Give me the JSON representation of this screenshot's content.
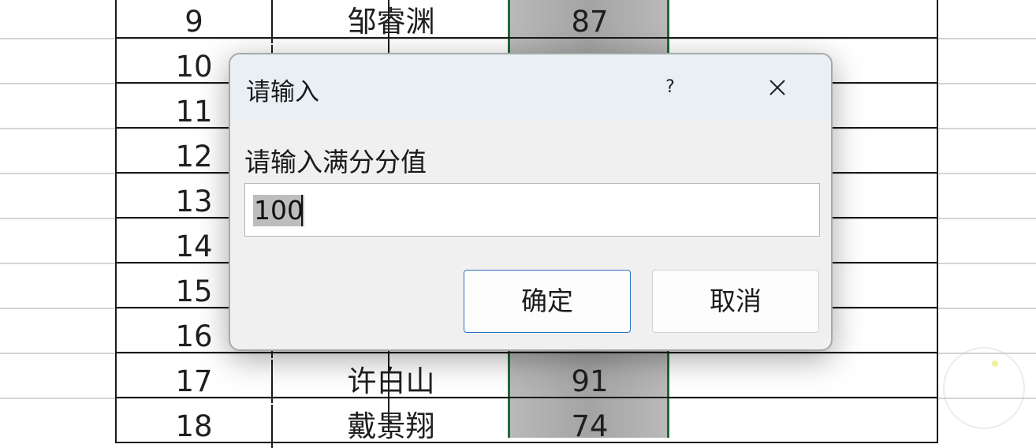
{
  "spreadsheet": {
    "rows": [
      {
        "num": "9",
        "name": "邹睿渊",
        "score": "87"
      },
      {
        "num": "10",
        "name": "",
        "score": ""
      },
      {
        "num": "11",
        "name": "",
        "score": ""
      },
      {
        "num": "12",
        "name": "",
        "score": ""
      },
      {
        "num": "13",
        "name": "",
        "score": ""
      },
      {
        "num": "14",
        "name": "",
        "score": ""
      },
      {
        "num": "15",
        "name": "",
        "score": ""
      },
      {
        "num": "16",
        "name": "",
        "score": ""
      },
      {
        "num": "17",
        "name": "许白山",
        "score": "91"
      },
      {
        "num": "18",
        "name": "戴景翔",
        "score": "74"
      }
    ]
  },
  "dialog": {
    "title": "请输入",
    "help_label": "?",
    "close_icon": "close-icon",
    "prompt": "请输入满分分值",
    "input_value": "100",
    "ok_label": "确定",
    "cancel_label": "取消"
  },
  "colors": {
    "selected_column_border": "#1e6b3a",
    "ok_button_border": "#2b72c4",
    "titlebar": "#e9f0f5"
  }
}
